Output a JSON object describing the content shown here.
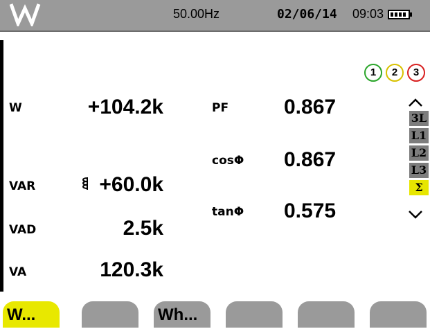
{
  "status": {
    "frequency": "50.00Hz",
    "date": "02/06/14",
    "time": "09:03",
    "mode_icon": "W",
    "battery_icon": "battery-icon"
  },
  "phases": [
    "1",
    "2",
    "3"
  ],
  "measurements": {
    "w": {
      "label": "W",
      "value": "+104.2k"
    },
    "var": {
      "label": "VAR",
      "value": "+60.0k"
    },
    "vad": {
      "label": "VAD",
      "value": "2.5k"
    },
    "va": {
      "label": "VA",
      "value": "120.3k"
    },
    "pf": {
      "label": "PF",
      "value": "0.867"
    },
    "cos": {
      "label": "cosΦ",
      "value": "0.867"
    },
    "tan": {
      "label": "tanΦ",
      "value": "0.575"
    }
  },
  "selector": {
    "items": [
      "3L",
      "L1",
      "L2",
      "L3",
      "Σ"
    ],
    "active": "Σ"
  },
  "tabs": [
    "W...",
    "",
    "Wh...",
    "",
    "",
    "",
    ""
  ],
  "colors": {
    "phase1": "#2aa52a",
    "phase2": "#d8c100",
    "phase3": "#d82020",
    "active_tab": "#e8e800",
    "status_bar": "#9a9a9a"
  }
}
